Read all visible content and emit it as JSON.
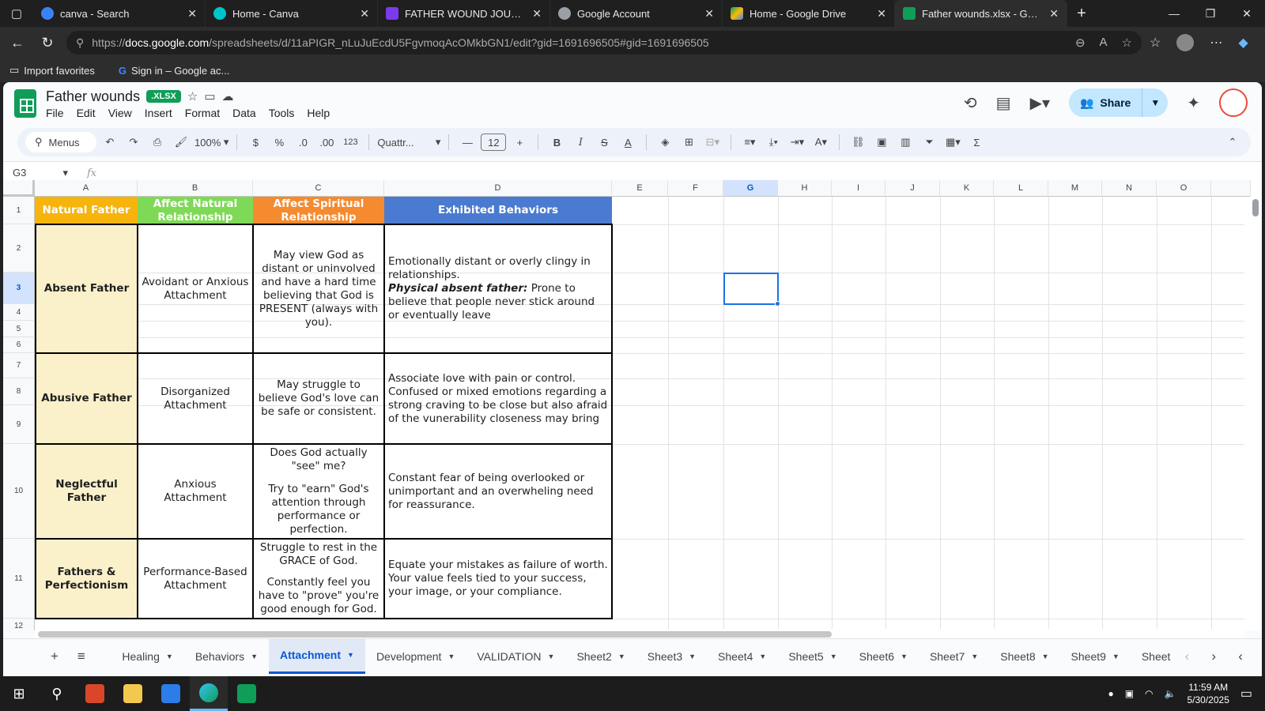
{
  "browser": {
    "tabs": [
      {
        "title": "canva - Search",
        "color": "#3b82f6"
      },
      {
        "title": "Home - Canva",
        "color": "#00c4cc"
      },
      {
        "title": "FATHER WOUND JOURNAL - S",
        "color": "#7c3aed"
      },
      {
        "title": "Google Account",
        "color": "#9aa0a6"
      },
      {
        "title": "Home - Google Drive",
        "color": "#fbbc04"
      },
      {
        "title": "Father wounds.xlsx - Google Sl",
        "color": "#0f9d58"
      }
    ],
    "active_tab": 5,
    "url_prefix": "https://",
    "url_host": "docs.google.com",
    "url_path": "/spreadsheets/d/11aPIGR_nLuJuEcdU5FgvmoqAcOMkbGN1/edit?gid=1691696505#gid=1691696505",
    "bookmarks": [
      "Import favorites",
      "Sign in – Google ac..."
    ]
  },
  "doc": {
    "title": "Father wounds",
    "badge": ".XLSX",
    "menu": [
      "File",
      "Edit",
      "View",
      "Insert",
      "Format",
      "Data",
      "Tools",
      "Help"
    ],
    "share_label": "Share"
  },
  "toolbar": {
    "menus_label": "Menus",
    "zoom": "100%",
    "currency": "$",
    "percent": "%",
    "dec_minus": ".0",
    "dec_plus": ".00",
    "number_format": "123",
    "font": "Quattr...",
    "font_size": "12"
  },
  "formula": {
    "cell_ref": "G3",
    "fx": "fx"
  },
  "grid": {
    "columns": [
      "A",
      "B",
      "C",
      "D",
      "E",
      "F",
      "G",
      "H",
      "I",
      "J",
      "K",
      "L",
      "M",
      "N",
      "O"
    ],
    "rows": [
      "1",
      "2",
      "3",
      "4",
      "5",
      "6",
      "7",
      "8",
      "9",
      "10",
      "11",
      "12"
    ],
    "selected_col": "G",
    "selected_row": "3",
    "header": {
      "a": "Natural Father",
      "b": "Affect Natural Relationship",
      "c": "Affect Spiritual Relationship",
      "d": "Exhibited Behaviors"
    },
    "header_colors": {
      "a": "#f6b40c",
      "b": "#7ed957",
      "c": "#f58a2f",
      "d": "#4a7bd0"
    },
    "rows_data": [
      {
        "a": "Absent Father",
        "b": "Avoidant or Anxious Attachment",
        "c": "May view God as distant or uninvolved and have a hard time believing that God is PRESENT (always with you).",
        "d_plain": "Emotionally distant or overly clingy in relationships.",
        "d_bold": "Physical absent father:",
        "d_rest": "Prone to believe that people  never stick around or eventually leave"
      },
      {
        "a": "Abusive Father",
        "b": "Disorganized Attachment",
        "c": "May struggle to believe God's love can be safe or consistent.",
        "d_plain": "Associate love with pain or control. Confused or mixed emotions regarding a strong craving to be close but also afraid of the vunerability closeness may bring"
      },
      {
        "a": "Neglectful Father",
        "b": "Anxious Attachment",
        "c1": "Does God actually \"see\" me?",
        "c2": "Try to \"earn\" God's attention through performance or perfection.",
        "d_plain": "Constant fear of being overlooked or unimportant and an overwheling need for reassurance."
      },
      {
        "a": "Fathers & Perfectionism",
        "b": "Performance-Based Attachment",
        "c1": "Struggle to rest in the GRACE of God.",
        "c2": "Constantly feel you have to \"prove\" you're good enough for God.",
        "d_plain": "Equate your mistakes as failure of worth. Your value feels tied to your success, your image, or your compliance."
      }
    ]
  },
  "sheets": [
    "Healing",
    "Behaviors",
    "Attachment",
    "Development",
    "VALIDATION",
    "Sheet2",
    "Sheet3",
    "Sheet4",
    "Sheet5",
    "Sheet6",
    "Sheet7",
    "Sheet8",
    "Sheet9",
    "Sheet"
  ],
  "active_sheet": "Attachment",
  "taskbar": {
    "time": "11:59 AM",
    "date": "5/30/2025"
  }
}
